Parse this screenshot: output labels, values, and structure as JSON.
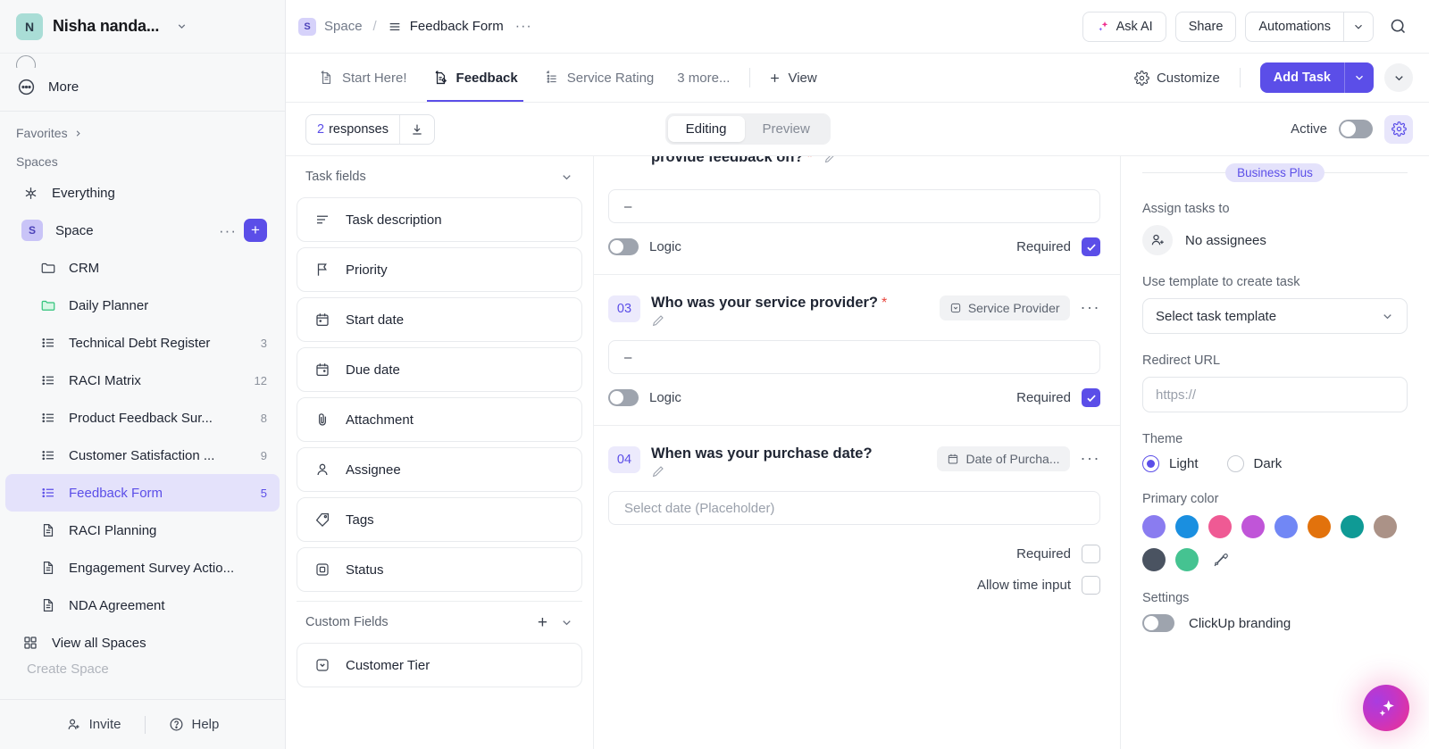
{
  "workspace": {
    "avatar_initial": "N",
    "name": "Nisha nanda...",
    "more_label": "More",
    "favorites_label": "Favorites",
    "spaces_label": "Spaces",
    "everything_label": "Everything",
    "space": {
      "badge": "S",
      "label": "Space"
    },
    "items": [
      {
        "label": "CRM",
        "count": "",
        "icon": "folder-icon",
        "indent": true
      },
      {
        "label": "Daily Planner",
        "count": "",
        "icon": "folder-green-icon",
        "indent": true
      },
      {
        "label": "Technical Debt Register",
        "count": "3",
        "icon": "list-icon",
        "indent": true
      },
      {
        "label": "RACI Matrix",
        "count": "12",
        "icon": "list-icon",
        "indent": true
      },
      {
        "label": "Product Feedback Sur...",
        "count": "8",
        "icon": "list-icon",
        "indent": true
      },
      {
        "label": "Customer Satisfaction ...",
        "count": "9",
        "icon": "list-icon",
        "indent": true
      },
      {
        "label": "Feedback Form",
        "count": "5",
        "icon": "list-icon",
        "indent": true,
        "active": true
      },
      {
        "label": "RACI Planning",
        "count": "",
        "icon": "doc-icon",
        "indent": true
      },
      {
        "label": "Engagement Survey Actio...",
        "count": "",
        "icon": "doc-icon",
        "indent": true
      },
      {
        "label": "NDA Agreement",
        "count": "",
        "icon": "doc-icon",
        "indent": true
      }
    ],
    "view_all_spaces": "View all Spaces",
    "footer": {
      "invite": "Invite",
      "help": "Help"
    }
  },
  "topbar": {
    "breadcrumb": {
      "space_badge": "S",
      "space": "Space",
      "separator": "/",
      "current": "Feedback Form",
      "dots": "···"
    },
    "ask_ai": "Ask AI",
    "share": "Share",
    "automations": "Automations"
  },
  "tabs": {
    "items": [
      {
        "label": "Start Here!",
        "icon": "doc-pin-icon",
        "active": false
      },
      {
        "label": "Feedback",
        "icon": "form-pin-icon",
        "active": true
      },
      {
        "label": "Service Rating",
        "icon": "list-pin-icon",
        "active": false
      }
    ],
    "more": "3 more...",
    "add_view": "View",
    "customize": "Customize",
    "add_task": "Add Task"
  },
  "toolbar": {
    "responses_count": "2",
    "responses_label": "responses",
    "segment": {
      "editing": "Editing",
      "preview": "Preview",
      "selected": "Editing"
    },
    "active_label": "Active",
    "active_on": false
  },
  "fields_panel": {
    "task_fields_title": "Task fields",
    "task_fields": [
      {
        "label": "Task description",
        "icon": "text-lines-icon"
      },
      {
        "label": "Priority",
        "icon": "flag-icon"
      },
      {
        "label": "Start date",
        "icon": "calendar-icon"
      },
      {
        "label": "Due date",
        "icon": "calendar-icon"
      },
      {
        "label": "Attachment",
        "icon": "paperclip-icon"
      },
      {
        "label": "Assignee",
        "icon": "person-icon"
      },
      {
        "label": "Tags",
        "icon": "tag-icon"
      },
      {
        "label": "Status",
        "icon": "status-square-icon"
      }
    ],
    "custom_fields_title": "Custom Fields",
    "custom_fields": [
      {
        "label": "Customer Tier",
        "icon": "dropdown-square-icon"
      }
    ]
  },
  "form": {
    "questions": [
      {
        "number": "",
        "title": "provide feedback on?",
        "required_star": "*",
        "field_tag": "",
        "input_value": "–",
        "input_placeholder": "",
        "logic_label": "Logic",
        "logic_on": false,
        "required_label": "Required",
        "required_checked": true,
        "partial": true
      },
      {
        "number": "03",
        "title": "Who was your service provider?",
        "required_star": "*",
        "field_tag": "Service Provider",
        "field_tag_icon": "dropdown-square-icon",
        "input_value": "–",
        "input_placeholder": "",
        "logic_label": "Logic",
        "logic_on": false,
        "required_label": "Required",
        "required_checked": true,
        "partial": false
      },
      {
        "number": "04",
        "title": "When was your purchase date?",
        "required_star": "",
        "field_tag": "Date of Purcha...",
        "field_tag_icon": "calendar-icon",
        "input_value": "",
        "input_placeholder": "Select date (Placeholder)",
        "required_label": "Required",
        "required_checked": false,
        "allow_time_label": "Allow time input",
        "allow_time_checked": false,
        "partial": false
      }
    ]
  },
  "settings": {
    "plan_badge": "Business Plus",
    "assign_label": "Assign tasks to",
    "assignee_value": "No assignees",
    "template_label": "Use template to create task",
    "template_value": "Select task template",
    "redirect_label": "Redirect URL",
    "redirect_placeholder": "https://",
    "theme_label": "Theme",
    "theme_light": "Light",
    "theme_dark": "Dark",
    "theme_selected": "Light",
    "primary_color_label": "Primary color",
    "swatches": [
      "#8a7cf0",
      "#1a8fe0",
      "#ef5a94",
      "#c055d8",
      "#7187f5",
      "#e2720c",
      "#0f9a95",
      "#ab9287",
      "#4a5361",
      "#45c391"
    ],
    "settings_label": "Settings",
    "branding_label": "ClickUp branding",
    "branding_on": false
  }
}
